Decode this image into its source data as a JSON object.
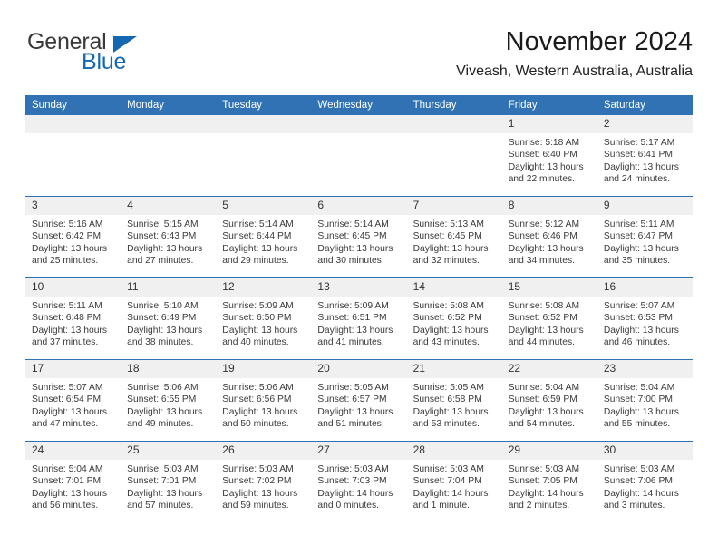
{
  "brand": {
    "name_top": "General",
    "name_bottom": "Blue",
    "triangle_color": "#1268B3"
  },
  "header": {
    "title": "November 2024",
    "subtitle": "Viveash, Western Australia, Australia"
  },
  "theme": {
    "header_blue": "#3072B4",
    "daynum_band": "#F0F0F0",
    "text": "#3a3a3a"
  },
  "calendar": {
    "weekday_headers": [
      "Sunday",
      "Monday",
      "Tuesday",
      "Wednesday",
      "Thursday",
      "Friday",
      "Saturday"
    ],
    "weeks": [
      [
        {
          "blank": true
        },
        {
          "blank": true
        },
        {
          "blank": true
        },
        {
          "blank": true
        },
        {
          "blank": true
        },
        {
          "day": "1",
          "sunrise": "Sunrise: 5:18 AM",
          "sunset": "Sunset: 6:40 PM",
          "daylight": "Daylight: 13 hours and 22 minutes."
        },
        {
          "day": "2",
          "sunrise": "Sunrise: 5:17 AM",
          "sunset": "Sunset: 6:41 PM",
          "daylight": "Daylight: 13 hours and 24 minutes."
        }
      ],
      [
        {
          "day": "3",
          "sunrise": "Sunrise: 5:16 AM",
          "sunset": "Sunset: 6:42 PM",
          "daylight": "Daylight: 13 hours and 25 minutes."
        },
        {
          "day": "4",
          "sunrise": "Sunrise: 5:15 AM",
          "sunset": "Sunset: 6:43 PM",
          "daylight": "Daylight: 13 hours and 27 minutes."
        },
        {
          "day": "5",
          "sunrise": "Sunrise: 5:14 AM",
          "sunset": "Sunset: 6:44 PM",
          "daylight": "Daylight: 13 hours and 29 minutes."
        },
        {
          "day": "6",
          "sunrise": "Sunrise: 5:14 AM",
          "sunset": "Sunset: 6:45 PM",
          "daylight": "Daylight: 13 hours and 30 minutes."
        },
        {
          "day": "7",
          "sunrise": "Sunrise: 5:13 AM",
          "sunset": "Sunset: 6:45 PM",
          "daylight": "Daylight: 13 hours and 32 minutes."
        },
        {
          "day": "8",
          "sunrise": "Sunrise: 5:12 AM",
          "sunset": "Sunset: 6:46 PM",
          "daylight": "Daylight: 13 hours and 34 minutes."
        },
        {
          "day": "9",
          "sunrise": "Sunrise: 5:11 AM",
          "sunset": "Sunset: 6:47 PM",
          "daylight": "Daylight: 13 hours and 35 minutes."
        }
      ],
      [
        {
          "day": "10",
          "sunrise": "Sunrise: 5:11 AM",
          "sunset": "Sunset: 6:48 PM",
          "daylight": "Daylight: 13 hours and 37 minutes."
        },
        {
          "day": "11",
          "sunrise": "Sunrise: 5:10 AM",
          "sunset": "Sunset: 6:49 PM",
          "daylight": "Daylight: 13 hours and 38 minutes."
        },
        {
          "day": "12",
          "sunrise": "Sunrise: 5:09 AM",
          "sunset": "Sunset: 6:50 PM",
          "daylight": "Daylight: 13 hours and 40 minutes."
        },
        {
          "day": "13",
          "sunrise": "Sunrise: 5:09 AM",
          "sunset": "Sunset: 6:51 PM",
          "daylight": "Daylight: 13 hours and 41 minutes."
        },
        {
          "day": "14",
          "sunrise": "Sunrise: 5:08 AM",
          "sunset": "Sunset: 6:52 PM",
          "daylight": "Daylight: 13 hours and 43 minutes."
        },
        {
          "day": "15",
          "sunrise": "Sunrise: 5:08 AM",
          "sunset": "Sunset: 6:52 PM",
          "daylight": "Daylight: 13 hours and 44 minutes."
        },
        {
          "day": "16",
          "sunrise": "Sunrise: 5:07 AM",
          "sunset": "Sunset: 6:53 PM",
          "daylight": "Daylight: 13 hours and 46 minutes."
        }
      ],
      [
        {
          "day": "17",
          "sunrise": "Sunrise: 5:07 AM",
          "sunset": "Sunset: 6:54 PM",
          "daylight": "Daylight: 13 hours and 47 minutes."
        },
        {
          "day": "18",
          "sunrise": "Sunrise: 5:06 AM",
          "sunset": "Sunset: 6:55 PM",
          "daylight": "Daylight: 13 hours and 49 minutes."
        },
        {
          "day": "19",
          "sunrise": "Sunrise: 5:06 AM",
          "sunset": "Sunset: 6:56 PM",
          "daylight": "Daylight: 13 hours and 50 minutes."
        },
        {
          "day": "20",
          "sunrise": "Sunrise: 5:05 AM",
          "sunset": "Sunset: 6:57 PM",
          "daylight": "Daylight: 13 hours and 51 minutes."
        },
        {
          "day": "21",
          "sunrise": "Sunrise: 5:05 AM",
          "sunset": "Sunset: 6:58 PM",
          "daylight": "Daylight: 13 hours and 53 minutes."
        },
        {
          "day": "22",
          "sunrise": "Sunrise: 5:04 AM",
          "sunset": "Sunset: 6:59 PM",
          "daylight": "Daylight: 13 hours and 54 minutes."
        },
        {
          "day": "23",
          "sunrise": "Sunrise: 5:04 AM",
          "sunset": "Sunset: 7:00 PM",
          "daylight": "Daylight: 13 hours and 55 minutes."
        }
      ],
      [
        {
          "day": "24",
          "sunrise": "Sunrise: 5:04 AM",
          "sunset": "Sunset: 7:01 PM",
          "daylight": "Daylight: 13 hours and 56 minutes."
        },
        {
          "day": "25",
          "sunrise": "Sunrise: 5:03 AM",
          "sunset": "Sunset: 7:01 PM",
          "daylight": "Daylight: 13 hours and 57 minutes."
        },
        {
          "day": "26",
          "sunrise": "Sunrise: 5:03 AM",
          "sunset": "Sunset: 7:02 PM",
          "daylight": "Daylight: 13 hours and 59 minutes."
        },
        {
          "day": "27",
          "sunrise": "Sunrise: 5:03 AM",
          "sunset": "Sunset: 7:03 PM",
          "daylight": "Daylight: 14 hours and 0 minutes."
        },
        {
          "day": "28",
          "sunrise": "Sunrise: 5:03 AM",
          "sunset": "Sunset: 7:04 PM",
          "daylight": "Daylight: 14 hours and 1 minute."
        },
        {
          "day": "29",
          "sunrise": "Sunrise: 5:03 AM",
          "sunset": "Sunset: 7:05 PM",
          "daylight": "Daylight: 14 hours and 2 minutes."
        },
        {
          "day": "30",
          "sunrise": "Sunrise: 5:03 AM",
          "sunset": "Sunset: 7:06 PM",
          "daylight": "Daylight: 14 hours and 3 minutes."
        }
      ]
    ]
  }
}
